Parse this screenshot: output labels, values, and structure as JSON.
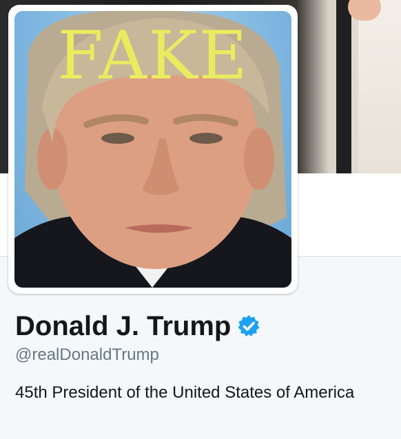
{
  "avatar": {
    "overlay_text": "FAKE",
    "overlay_color": "#e9ec5f"
  },
  "profile": {
    "name": "Donald J. Trump",
    "verified_icon": "verified-badge-icon",
    "verified_color": "#1da1f2",
    "handle": "@realDonaldTrump",
    "bio": "45th President of the United States of America"
  },
  "colors": {
    "page_background": "#f5f8fa",
    "name_text": "#14171a",
    "handle_text": "#657786"
  }
}
